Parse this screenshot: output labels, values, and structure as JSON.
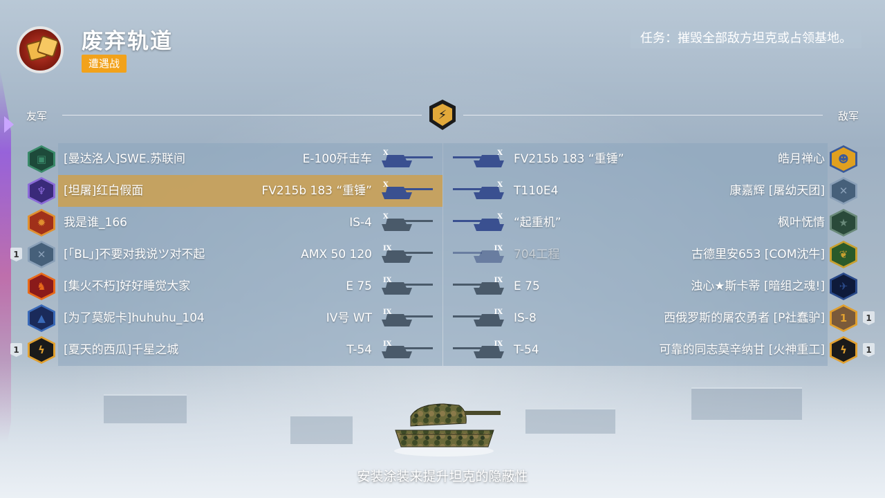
{
  "map": {
    "title": "废弃轨道",
    "mode": "遭遇战"
  },
  "mission": "任务：摧毁全部敌方坦克或占领基地。",
  "labels": {
    "allies": "友军",
    "enemies": "敌军"
  },
  "tip": "安装涂装来提升坦克的隐蔽性",
  "colors": {
    "highlight": "#cda050",
    "mode_badge": "#f2a21b",
    "panel": "#8ca5be"
  },
  "allies": [
    {
      "player": "[曼达洛人]SWE.苏联间",
      "tank": "E-100歼击车",
      "tier": "X",
      "avatar": "tank-emblem-icon",
      "platoon": ""
    },
    {
      "player": "[坦屠]红白假面",
      "tank": "FV215b 183 “重锤”",
      "tier": "X",
      "avatar": "sword-emblem-icon",
      "platoon": "",
      "highlight": true
    },
    {
      "player": "我是谁_166",
      "tank": "IS-4",
      "tier": "X",
      "avatar": "medal-emblem-icon",
      "platoon": ""
    },
    {
      "player": "[「BL」]不要对我说ツ对不起",
      "tank": "AMX 50 120",
      "tier": "IX",
      "avatar": "crossed-swords-icon",
      "platoon": "1"
    },
    {
      "player": "[集火不朽]好好睡觉大家",
      "tank": "E 75",
      "tier": "IX",
      "avatar": "phoenix-emblem-icon",
      "platoon": ""
    },
    {
      "player": "[为了莫妮卡]huhuhu_104",
      "tank": "IV号 WT",
      "tier": "IX",
      "avatar": "triangle-emblem-icon",
      "platoon": ""
    },
    {
      "player": "[夏天的西瓜]千星之城",
      "tank": "T-54",
      "tier": "IX",
      "avatar": "lightning-emblem-icon",
      "platoon": "1"
    }
  ],
  "enemies": [
    {
      "player": "皓月禅心",
      "tank": "FV215b 183 “重锤”",
      "tier": "X",
      "avatar": "face-emblem-icon",
      "platoon": ""
    },
    {
      "player": "康嘉辉 [屠幼天团]",
      "tank": "T110E4",
      "tier": "X",
      "avatar": "crossed-swords-icon",
      "platoon": ""
    },
    {
      "player": "枫叶怃情",
      "tank": "“起重机”",
      "tier": "X",
      "avatar": "star-emblem-icon",
      "platoon": ""
    },
    {
      "player": "古德里安653 [COM沈牛]",
      "tank": "704工程",
      "tier": "IX",
      "avatar": "wreath-emblem-icon",
      "platoon": "",
      "dead": true
    },
    {
      "player": "浊心★斯卡蒂 [暗组之魂!]",
      "tank": "E 75",
      "tier": "IX",
      "avatar": "gun-emblem-icon",
      "platoon": ""
    },
    {
      "player": "西俄罗斯的屠农勇者 [P社蠢驴]",
      "tank": "IS-8",
      "tier": "IX",
      "avatar": "number-one-emblem-icon",
      "platoon": "1"
    },
    {
      "player": "可靠的同志莫辛纳甘 [火神重工]",
      "tank": "T-54",
      "tier": "IX",
      "avatar": "lightning-emblem-icon",
      "platoon": "1"
    }
  ]
}
